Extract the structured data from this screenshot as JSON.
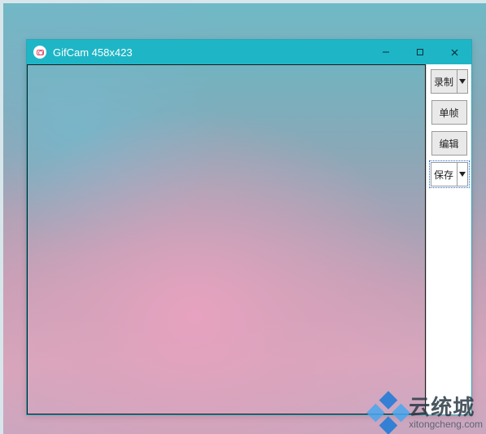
{
  "window": {
    "title": "GifCam 458x423"
  },
  "sidebar": {
    "record": "录制",
    "single_frame": "单帧",
    "edit": "编辑",
    "save": "保存"
  },
  "watermark": {
    "name": "云统城",
    "url": "xitongcheng.com"
  },
  "colors": {
    "titlebar": "#1eb6c6"
  }
}
